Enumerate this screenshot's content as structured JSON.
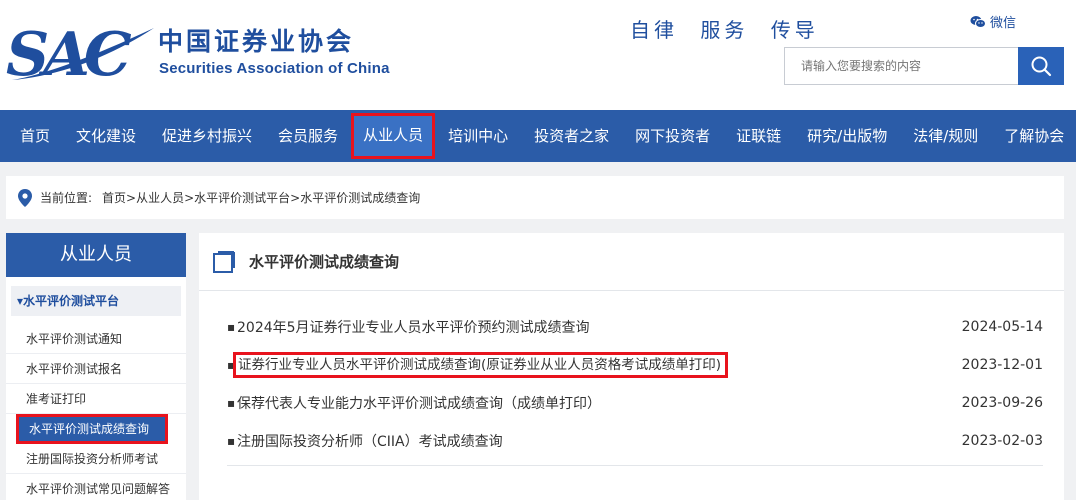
{
  "header": {
    "logo_letters": "SAC",
    "logo_cn": "中国证券业协会",
    "logo_en": "Securities Association of China",
    "slogan": "自律 服务 传导",
    "wechat_label": "微信",
    "search_placeholder": "请输入您要搜索的内容"
  },
  "nav": {
    "items": [
      "首页",
      "文化建设",
      "促进乡村振兴",
      "会员服务",
      "从业人员",
      "培训中心",
      "投资者之家",
      "网下投资者",
      "证联链",
      "研究/出版物",
      "法律/规则",
      "了解协会"
    ],
    "active_index": 4
  },
  "breadcrumb": {
    "label": "当前位置:",
    "path": "首页>从业人员>水平评价测试平台>水平评价测试成绩查询"
  },
  "sidebar": {
    "title": "从业人员",
    "category": "▾水平评价测试平台",
    "items": [
      "水平评价测试通知",
      "水平评价测试报名",
      "准考证打印",
      "水平评价测试成绩查询",
      "注册国际投资分析师考试",
      "水平评价测试常见问题解答"
    ],
    "active_index": 3
  },
  "main": {
    "title": "水平评价测试成绩查询",
    "list": [
      {
        "title": "2024年5月证券行业专业人员水平评价预约测试成绩查询",
        "date": "2024-05-14"
      },
      {
        "title": "证券行业专业人员水平评价测试成绩查询(原证券业从业人员资格考试成绩单打印)",
        "date": "2023-12-01"
      },
      {
        "title": "保荐代表人专业能力水平评价测试成绩查询（成绩单打印）",
        "date": "2023-09-26"
      },
      {
        "title": "注册国际投资分析师（CIIA）考试成绩查询",
        "date": "2023-02-03"
      }
    ]
  },
  "colors": {
    "brand_blue": "#2b5ca8",
    "highlight_red": "#e8131d"
  }
}
